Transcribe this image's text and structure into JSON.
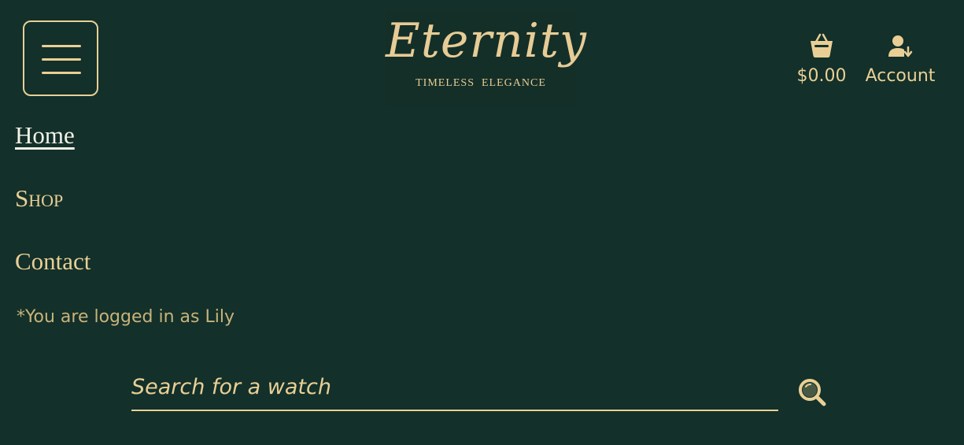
{
  "header": {
    "menu_button": {
      "icon": "hamburger-menu-icon"
    },
    "logo": {
      "wordmark": "Eternity",
      "tagline": "TIMELESS  ELEGANCE"
    },
    "cart": {
      "icon": "shopping-basket-icon",
      "total": "$0.00"
    },
    "account": {
      "icon": "user-download-icon",
      "label": "Account"
    }
  },
  "nav": {
    "items": [
      {
        "label": "Home",
        "active": true
      },
      {
        "label": "Shop",
        "active": false
      },
      {
        "label": "Contact",
        "active": false
      }
    ]
  },
  "status": {
    "logged_in_text": "*You are logged in as Lily"
  },
  "search": {
    "placeholder": "Search for a watch",
    "value": "",
    "icon": "search-icon"
  },
  "colors": {
    "background": "#13302a",
    "gold": "#e9cf95",
    "active_nav": "#f3f1e8"
  }
}
